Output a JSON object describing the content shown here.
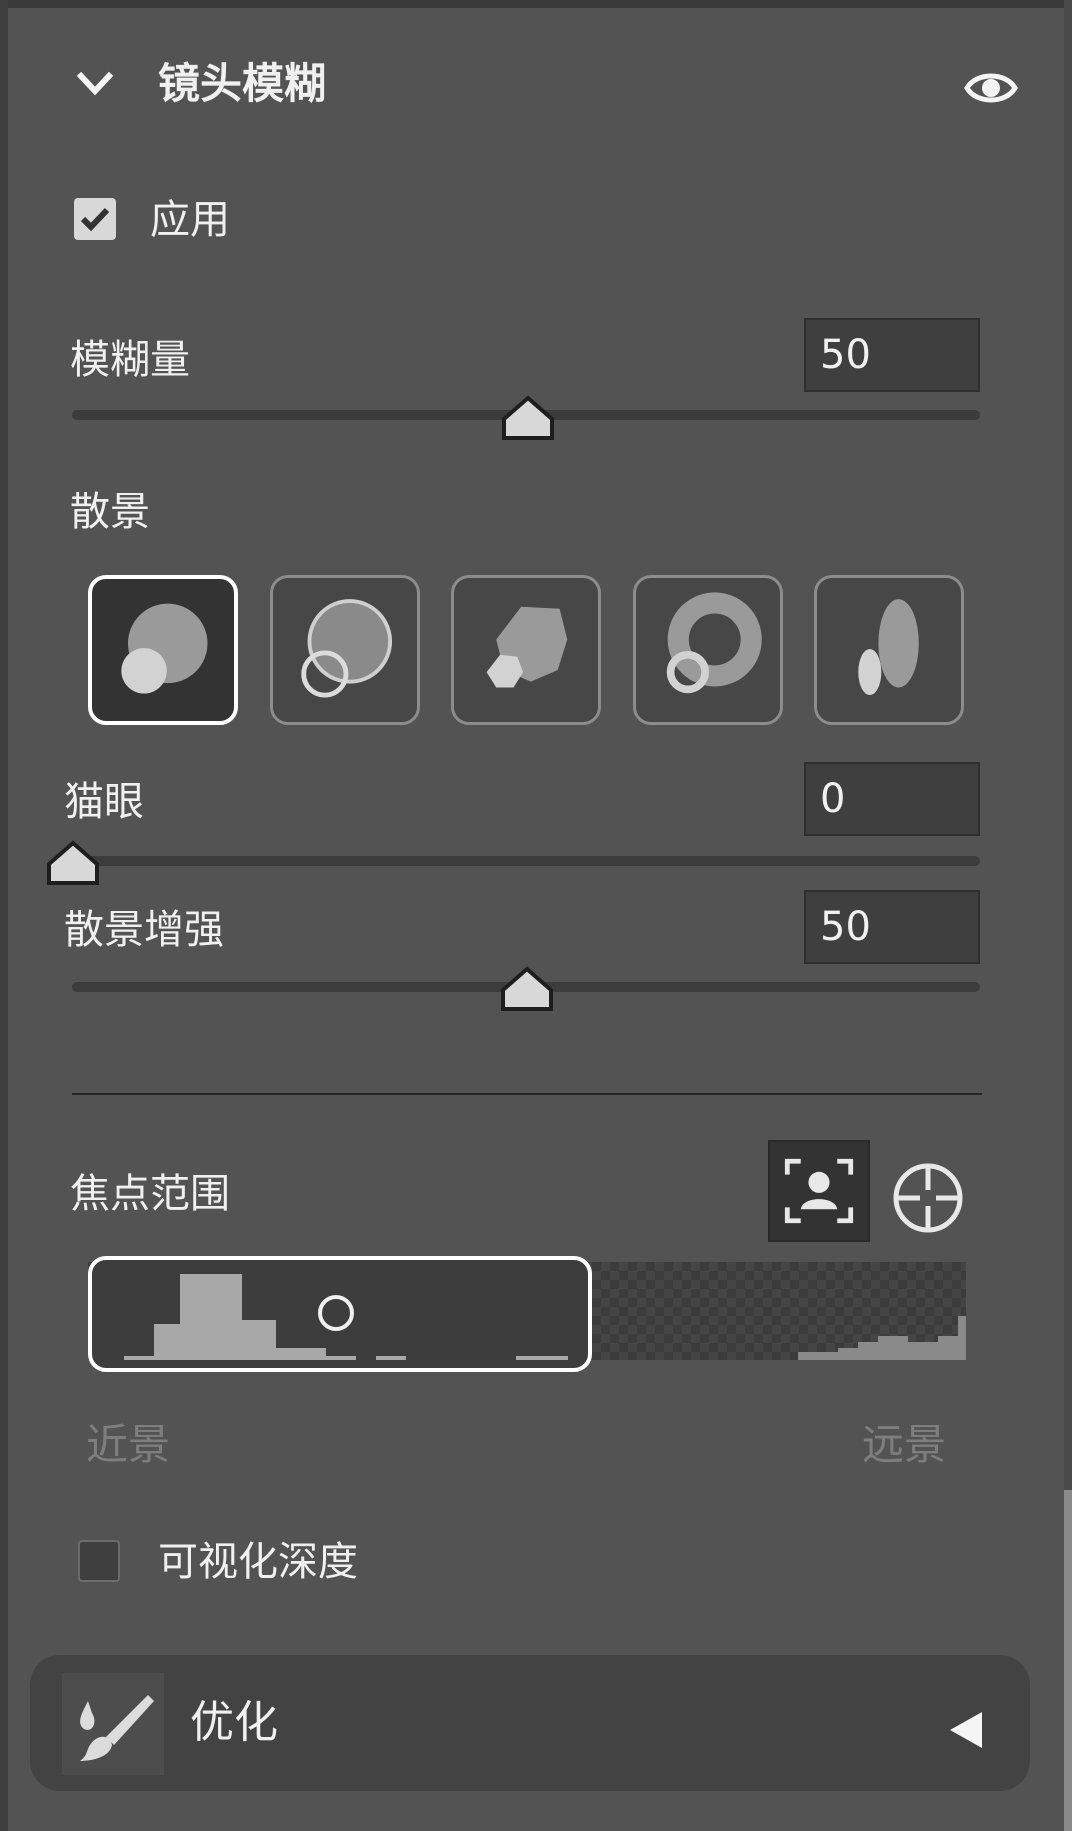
{
  "panel": {
    "title": "镜头模糊",
    "icons": {
      "collapse": "chevron-down-icon",
      "visibility": "eye-icon"
    }
  },
  "apply": {
    "label": "应用",
    "checked": true
  },
  "blur_amount": {
    "label": "模糊量",
    "value": "50",
    "level": 50
  },
  "bokeh": {
    "label": "散景",
    "shapes": [
      {
        "name": "bokeh-shape-round-icon",
        "selected": true
      },
      {
        "name": "bokeh-shape-ring-icon",
        "selected": false
      },
      {
        "name": "bokeh-shape-blade-icon",
        "selected": false
      },
      {
        "name": "bokeh-shape-donut-icon",
        "selected": false
      },
      {
        "name": "bokeh-shape-oval-icon",
        "selected": false
      }
    ]
  },
  "cat_eye": {
    "label": "猫眼",
    "value": "0",
    "level": 0
  },
  "bokeh_boost": {
    "label": "散景增强",
    "value": "50",
    "level": 50
  },
  "focus_range": {
    "label": "焦点范围",
    "icons": {
      "subject": "face-focus-icon",
      "target": "crosshair-icon"
    },
    "near_label": "近景",
    "far_label": "远景"
  },
  "visualize_depth": {
    "label": "可视化深度",
    "checked": false
  },
  "refine": {
    "label": "优化",
    "icons": {
      "brush": "brush-icon",
      "expand": "triangle-left-icon"
    }
  },
  "colors": {
    "background": "#535353",
    "field": "#3f3f3f",
    "accent": "#ffffff"
  }
}
